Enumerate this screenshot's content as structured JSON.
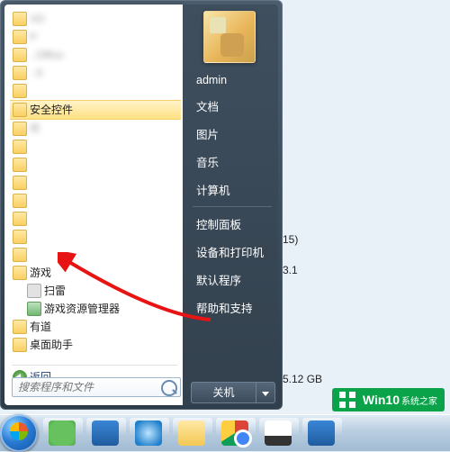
{
  "right_pane": {
    "username": "admin",
    "items": [
      "文档",
      "图片",
      "音乐",
      "计算机"
    ],
    "items2": [
      "控制面板",
      "设备和打印机",
      "默认程序",
      "帮助和支持"
    ],
    "shutdown": "关机"
  },
  "left_pane": {
    "items": [
      {
        "label": "VD",
        "type": "folder",
        "blur": true
      },
      {
        "label": "P",
        "type": "folder",
        "blur": true
      },
      {
        "label": ", Office",
        "type": "folder",
        "blur": true
      },
      {
        "label": "- 6",
        "type": "folder",
        "blur": true
      },
      {
        "label": "",
        "type": "folder",
        "blur": true
      },
      {
        "label": "安全控件",
        "type": "folder",
        "hi": true
      },
      {
        "label": "件",
        "type": "folder",
        "blur": true
      },
      {
        "label": "",
        "type": "folder",
        "blur": true
      },
      {
        "label": "",
        "type": "folder",
        "blur": true
      },
      {
        "label": "",
        "type": "folder",
        "blur": true
      },
      {
        "label": "",
        "type": "folder",
        "blur": true
      },
      {
        "label": "",
        "type": "folder",
        "blur": true
      },
      {
        "label": "",
        "type": "folder",
        "blur": true
      },
      {
        "label": "",
        "type": "folder",
        "blur": true
      },
      {
        "label": "游戏",
        "type": "folder",
        "expanded": true
      },
      {
        "label": "扫雷",
        "type": "scan",
        "ind": true
      },
      {
        "label": "游戏资源管理器",
        "type": "geman",
        "ind": true
      },
      {
        "label": "有道",
        "type": "folder"
      },
      {
        "label": "桌面助手",
        "type": "folder"
      }
    ],
    "back": "返回",
    "search_placeholder": "搜索程序和文件"
  },
  "bg_files": [
    {
      "name": "15)",
      "pos": 259
    },
    {
      "name": "3.1",
      "pos": 293
    },
    {
      "name": "5.12 GB",
      "pos": 414
    }
  ],
  "watermark": {
    "brand": "Win10",
    "site": "系统之家"
  }
}
